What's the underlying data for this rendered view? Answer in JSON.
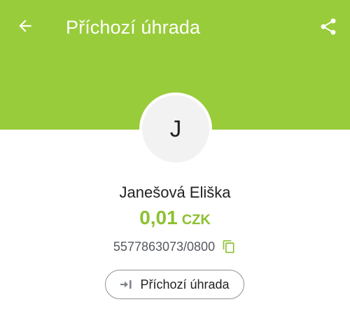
{
  "header": {
    "title": "Příchozí úhrada",
    "background_color": "#98cc3a",
    "back_icon": "arrow-left-icon",
    "share_icon": "share-icon"
  },
  "counterparty": {
    "avatar_initial": "J",
    "name": "Janešová Eliška",
    "account": "5577863073/0800",
    "copy_icon": "copy-icon"
  },
  "payment": {
    "amount": "0,01",
    "currency": "CZK",
    "amount_color": "#8cc131"
  },
  "type_chip": {
    "label": "Příchozí úhrada",
    "icon": "incoming-transfer-icon"
  }
}
